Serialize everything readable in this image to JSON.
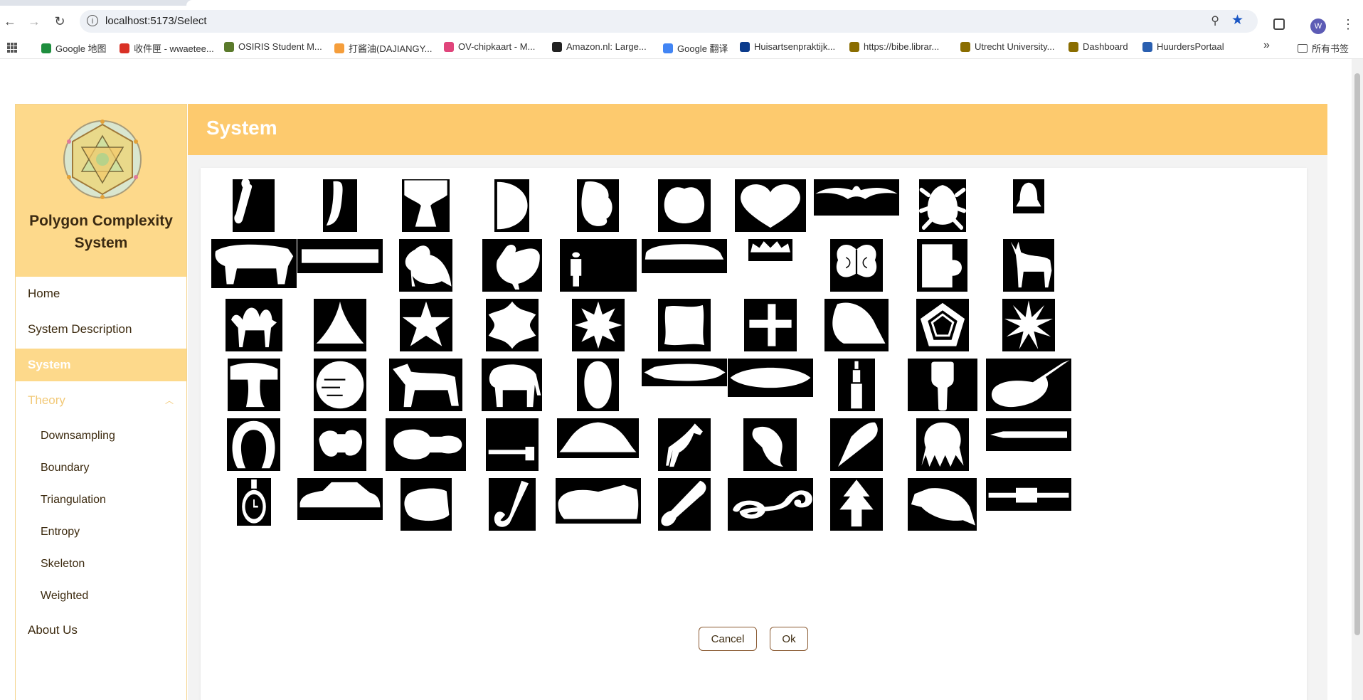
{
  "browser": {
    "url": "localhost:5173/Select",
    "avatar_letter": "W",
    "bookmarks": [
      {
        "label": "Google 地图",
        "color": "#1e8e3e"
      },
      {
        "label": "收件匣 - wwaetee...",
        "color": "#d93025"
      },
      {
        "label": "OSIRIS Student M...",
        "color": "#5a7a2b"
      },
      {
        "label": "打酱油(DAJIANGY...",
        "color": "#f59e3b"
      },
      {
        "label": "OV-chipkaart - M...",
        "color": "#e0457b"
      },
      {
        "label": "Amazon.nl: Large...",
        "color": "#222222"
      },
      {
        "label": "Google 翻译",
        "color": "#4285f4"
      },
      {
        "label": "Huisartsenpraktijk...",
        "color": "#0b3b8c"
      },
      {
        "label": "https://bibe.librar...",
        "color": "#8a6d00"
      },
      {
        "label": "Utrecht University...",
        "color": "#8a6d00"
      },
      {
        "label": "Dashboard",
        "color": "#8a6d00"
      },
      {
        "label": "HuurdersPortaal",
        "color": "#2a5fb0"
      }
    ],
    "more": "»",
    "bookmarks_folder": "所有书签"
  },
  "sidebar": {
    "brand_line1": "Polygon Complexity",
    "brand_line2": "System",
    "items": [
      {
        "label": "Home"
      },
      {
        "label": "System Description"
      },
      {
        "label": "System"
      },
      {
        "label": "Theory"
      },
      {
        "label": "Downsampling"
      },
      {
        "label": "Boundary"
      },
      {
        "label": "Triangulation"
      },
      {
        "label": "Entropy"
      },
      {
        "label": "Skeleton"
      },
      {
        "label": "Weighted"
      },
      {
        "label": "About Us"
      }
    ]
  },
  "header": {
    "title": "System"
  },
  "shapes": {
    "rows": [
      [
        "bone",
        "leaf-strip",
        "goblet",
        "half-disc",
        "blob",
        "apple",
        "heart",
        "bat",
        "beetle",
        "bell"
      ],
      [
        "cow",
        "bar",
        "bird",
        "rooster",
        "child",
        "car",
        "crown",
        "butterfly",
        "mug",
        "deer"
      ],
      [
        "camel",
        "hat-cone",
        "flower-5",
        "flower-6",
        "star-8",
        "square-wavy",
        "windmill",
        "frog",
        "pentagon-spiral",
        "star-12"
      ],
      [
        "tee",
        "disc-lines",
        "dog",
        "elephant",
        "head",
        "fish",
        "lemon",
        "ant",
        "fork",
        "guitar"
      ],
      [
        "horseshoe",
        "flask",
        "guitar-body",
        "hammer",
        "hat",
        "horse",
        "lizard",
        "carrot",
        "octopus",
        "pencil"
      ],
      [
        "pocket-watch",
        "car-side",
        "rat",
        "hook",
        "shoe",
        "spoon",
        "spiral",
        "tree",
        "turtle",
        "watch"
      ]
    ]
  },
  "actions": {
    "cancel_label": "Cancel",
    "ok_label": "Ok"
  }
}
